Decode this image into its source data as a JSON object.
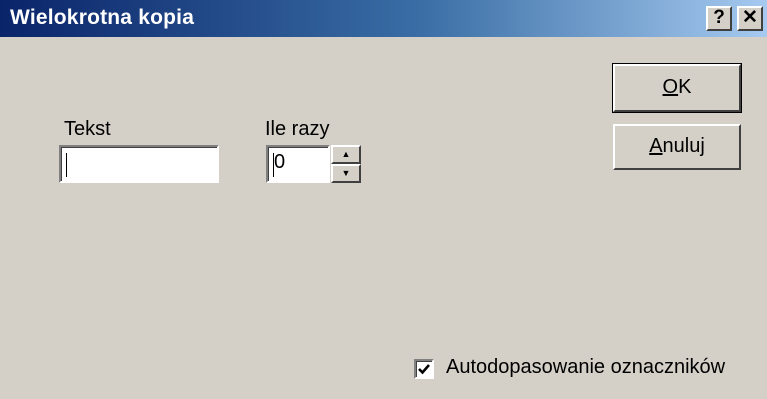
{
  "window": {
    "title": "Wielokrotna kopia",
    "help_label": "?",
    "close_label": "✕",
    "colors": {
      "titlebar_start": "#0a246a",
      "titlebar_end": "#a6caf0",
      "face": "#d4d0c8"
    }
  },
  "form": {
    "text_label": "Tekst",
    "text_value": "",
    "count_label": "Ile razy",
    "count_value": "0"
  },
  "buttons": {
    "ok_accel": "O",
    "ok_rest": "K",
    "cancel_accel": "A",
    "cancel_rest": "nuluj"
  },
  "checkbox": {
    "label": "Autodopasowanie oznaczników",
    "checked": true
  }
}
